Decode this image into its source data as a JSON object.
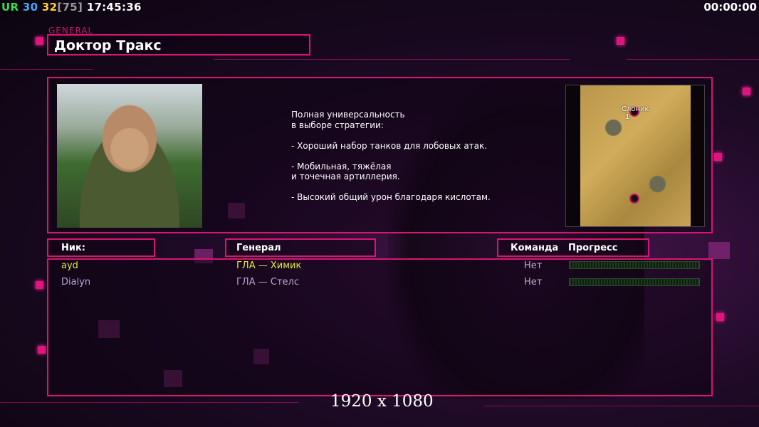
{
  "hud": {
    "ur_label": "UR",
    "fps": "30",
    "fps_target": "32",
    "fps_bracket": "[75]",
    "clock": "17:45:36",
    "timer": "00:00:00"
  },
  "header": {
    "tag": "GENERAL",
    "title": "Доктор Тракс"
  },
  "description": [
    "Полная универсальность",
    "в выборе стратегии:",
    "",
    "- Хороший набор танков для лобовых атак.",
    "",
    "- Мобильная, тяжёлая",
    "и точечная артиллерия.",
    "",
    "- Высокий общий урон благодаря кислотам."
  ],
  "minimap": {
    "map_name": "Слоник",
    "slot_number": "1"
  },
  "table": {
    "headers": {
      "nick": "Ник:",
      "general": "Генерал",
      "team": "Команда",
      "progress": "Прогресс"
    },
    "rows": [
      {
        "nick": "ayd",
        "general": "ГЛА — Химик",
        "team": "Нет",
        "progress": 0
      },
      {
        "nick": "Dialyn",
        "general": "ГЛА — Стелс",
        "team": "Нет",
        "progress": 0
      }
    ]
  },
  "resolution": "1920 x 1080",
  "colors": {
    "accent": "#d8156f",
    "player1": "#e6e640",
    "player2": "#b9a6d4"
  }
}
